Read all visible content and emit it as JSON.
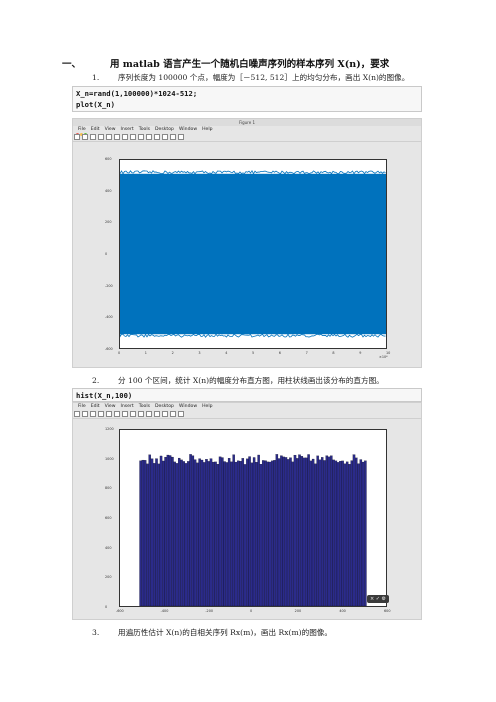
{
  "heading": {
    "number": "一、",
    "text": "用 matlab 语言产生一个随机白噪声序列的样本序列 X(n)，要求"
  },
  "items": [
    {
      "number": "1.",
      "text": "序列长度为 100000 个点，幅度为［－512, 512］上的均匀分布，画出 X(n)的图像。"
    },
    {
      "number": "2.",
      "text": "分 100 个区间，统计 X(n)的幅度分布直方图，用柱状线画出该分布的直方图。"
    },
    {
      "number": "3.",
      "text": "用遍历性估计 X(n)的自相关序列 Rx(m)，画出 Rx(m)的图像。"
    }
  ],
  "code1": [
    "X_n=rand(1,100000)*1024-512;",
    "plot(X_n)"
  ],
  "code2": [
    "hist(X_n,100)"
  ],
  "window_title": "Figure 1",
  "menu": [
    "File",
    "Edit",
    "View",
    "Insert",
    "Tools",
    "Desktop",
    "Window",
    "Help"
  ],
  "colors": {
    "plot_blue": "#0072bd",
    "hist_fill": "#2b2b8a",
    "hist_edge": "#000000"
  },
  "hud": {
    "label": "× ✓ ⚙"
  },
  "chart_data": [
    {
      "type": "line",
      "description_source": "plot of uniform random samples",
      "x_range": [
        0,
        100000
      ],
      "ylim": [
        -600,
        600
      ],
      "y_band": [
        -512,
        512
      ],
      "yticks": [
        "600",
        "400",
        "200",
        "0",
        "-200",
        "-400",
        "-600"
      ],
      "xticks": [
        "0",
        "1",
        "2",
        "3",
        "4",
        "5",
        "6",
        "7",
        "8",
        "9",
        "10"
      ],
      "x_multiplier": "×10⁴"
    },
    {
      "type": "bar",
      "bins": 100,
      "xlim": [
        -600,
        600
      ],
      "ylim": [
        0,
        1200
      ],
      "approx_bin_count": 1000,
      "yticks": [
        "1200",
        "1000",
        "800",
        "600",
        "400",
        "200",
        "0"
      ],
      "xticks": [
        "-600",
        "-400",
        "-200",
        "0",
        "200",
        "400",
        "600"
      ]
    }
  ]
}
